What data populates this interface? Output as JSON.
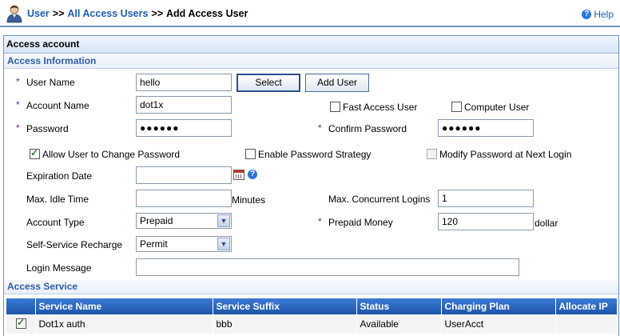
{
  "breadcrumb": {
    "root": "User",
    "parent": "All Access Users",
    "current": "Add Access User",
    "separator": ">>"
  },
  "help_label": "Help",
  "panel_title": "Access account",
  "sections": {
    "access_information": "Access Information",
    "access_service": "Access Service"
  },
  "form": {
    "user_name_label": "User Name",
    "user_name_value": "hello",
    "select_button": "Select",
    "add_user_button": "Add User",
    "account_name_label": "Account Name",
    "account_name_value": "dot1x",
    "fast_access_user_label": "Fast Access User",
    "fast_access_user_checked": false,
    "computer_user_label": "Computer User",
    "computer_user_checked": false,
    "password_label": "Password",
    "password_value": "●●●●●●",
    "confirm_password_label": "Confirm Password",
    "confirm_password_value": "●●●●●●",
    "allow_change_password_label": "Allow User to Change Password",
    "allow_change_password_checked": true,
    "enable_password_strategy_label": "Enable Password Strategy",
    "enable_password_strategy_checked": false,
    "modify_password_next_login_label": "Modify Password at Next Login",
    "modify_password_next_login_checked": false,
    "expiration_date_label": "Expiration Date",
    "expiration_date_value": "",
    "max_idle_time_label": "Max. Idle Time",
    "max_idle_time_value": "",
    "minutes_unit": "Minutes",
    "max_concurrent_logins_label": "Max. Concurrent Logins",
    "max_concurrent_logins_value": "1",
    "account_type_label": "Account Type",
    "account_type_value": "Prepaid",
    "prepaid_money_label": "Prepaid Money",
    "prepaid_money_value": "120",
    "dollar_unit": "dollar",
    "self_service_recharge_label": "Self-Service Recharge",
    "self_service_recharge_value": "Permit",
    "login_message_label": "Login Message",
    "login_message_value": "",
    "required_marker": "*"
  },
  "service_table": {
    "columns": [
      "Service Name",
      "Service Suffix",
      "Status",
      "Charging Plan",
      "Allocate IP"
    ],
    "rows": [
      {
        "checked": true,
        "service_name": "Dot1x auth",
        "service_suffix": "bbb",
        "status": "Available",
        "charging_plan": "UserAcct",
        "allocate_ip": ""
      }
    ]
  },
  "colors": {
    "link": "#1b5ebb",
    "section_text": "#2e5ea8",
    "table_header": "#2a66c0",
    "required_marker": "#6a2a8a"
  }
}
